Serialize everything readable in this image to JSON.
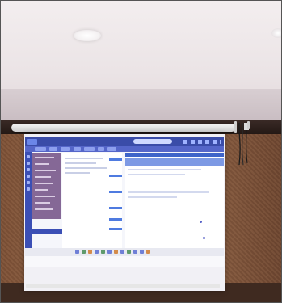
{
  "scene": {
    "description_tag": "photo-of-projector-screen",
    "colors": {
      "ceiling": "#ebe4e6",
      "wall": "#8a5e42",
      "projection_primary": "#3a4ca8",
      "projection_accent": "#4f7be0"
    }
  },
  "projected_ui": {
    "window_title": ""
  }
}
